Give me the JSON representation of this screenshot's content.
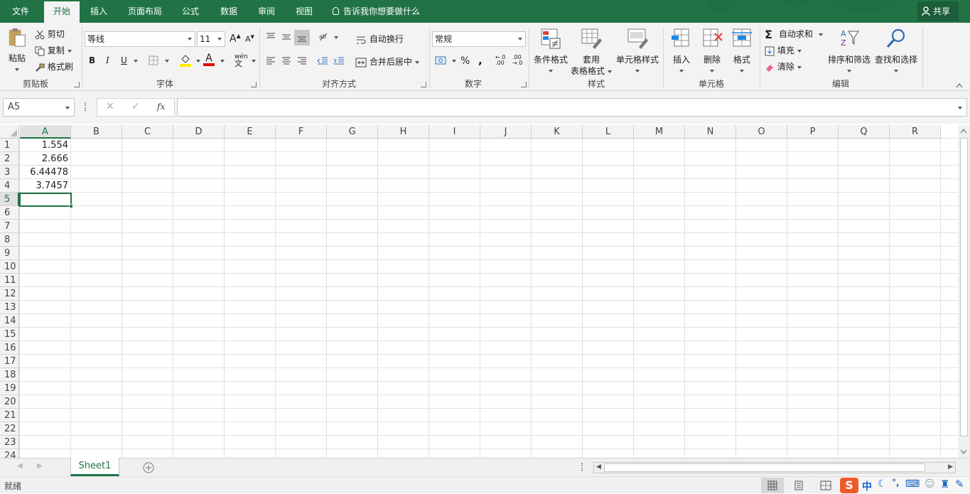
{
  "tabs": [
    {
      "label": "文件",
      "active": false
    },
    {
      "label": "开始",
      "active": true
    },
    {
      "label": "插入",
      "active": false
    },
    {
      "label": "页面布局",
      "active": false
    },
    {
      "label": "公式",
      "active": false
    },
    {
      "label": "数据",
      "active": false
    },
    {
      "label": "审阅",
      "active": false
    },
    {
      "label": "视图",
      "active": false
    }
  ],
  "tell_me": "告诉我你想要做什么",
  "share_label": "共享",
  "ribbon": {
    "clipboard": {
      "paste": "粘贴",
      "cut": "剪切",
      "copy": "复制",
      "format_painter": "格式刷",
      "label": "剪贴板"
    },
    "font": {
      "name": "等线",
      "size": "11",
      "bold": "B",
      "italic": "I",
      "underline": "U",
      "grow": "A",
      "shrink": "A",
      "phonetic": "wén",
      "label": "字体"
    },
    "alignment": {
      "wrap": "自动换行",
      "merge": "合并后居中",
      "label": "对齐方式"
    },
    "number": {
      "format": "常规",
      "percent": "%",
      "comma": ",",
      "inc_decimal": ".00",
      "dec_decimal": ".00",
      "label": "数字"
    },
    "styles": {
      "conditional": "条件格式",
      "table_line1": "套用",
      "table_line2": "表格格式",
      "cell_styles": "单元格样式",
      "label": "样式"
    },
    "cells": {
      "insert": "插入",
      "delete": "删除",
      "format": "格式",
      "label": "单元格"
    },
    "editing": {
      "autosum": "自动求和",
      "fill": "填充",
      "clear": "清除",
      "sort": "排序和筛选",
      "find": "查找和选择",
      "label": "编辑"
    }
  },
  "formula_bar": {
    "name_box": "A5",
    "cancel": "✕",
    "enter": "✓",
    "fx": "fx",
    "content": ""
  },
  "columns": [
    "A",
    "B",
    "C",
    "D",
    "E",
    "F",
    "G",
    "H",
    "I",
    "J",
    "K",
    "L",
    "M",
    "N",
    "O",
    "P",
    "Q",
    "R"
  ],
  "rows": [
    "1",
    "2",
    "3",
    "4",
    "5",
    "6",
    "7",
    "8",
    "9",
    "10",
    "11",
    "12",
    "13",
    "14",
    "15",
    "16",
    "17",
    "18",
    "19",
    "20",
    "21",
    "22",
    "23",
    "24"
  ],
  "cells_A": [
    "1.554",
    "2.666",
    "6.44478",
    "3.7457"
  ],
  "active_cell": "A5",
  "sheet_tab": "Sheet1",
  "status": "就绪",
  "ime": {
    "zh": "中"
  },
  "colors": {
    "accent": "#217346",
    "ribbon_bg": "#f3f3f3",
    "selection": "#217346",
    "underline_yellow": "#ffeb00",
    "font_red": "#e00000"
  }
}
